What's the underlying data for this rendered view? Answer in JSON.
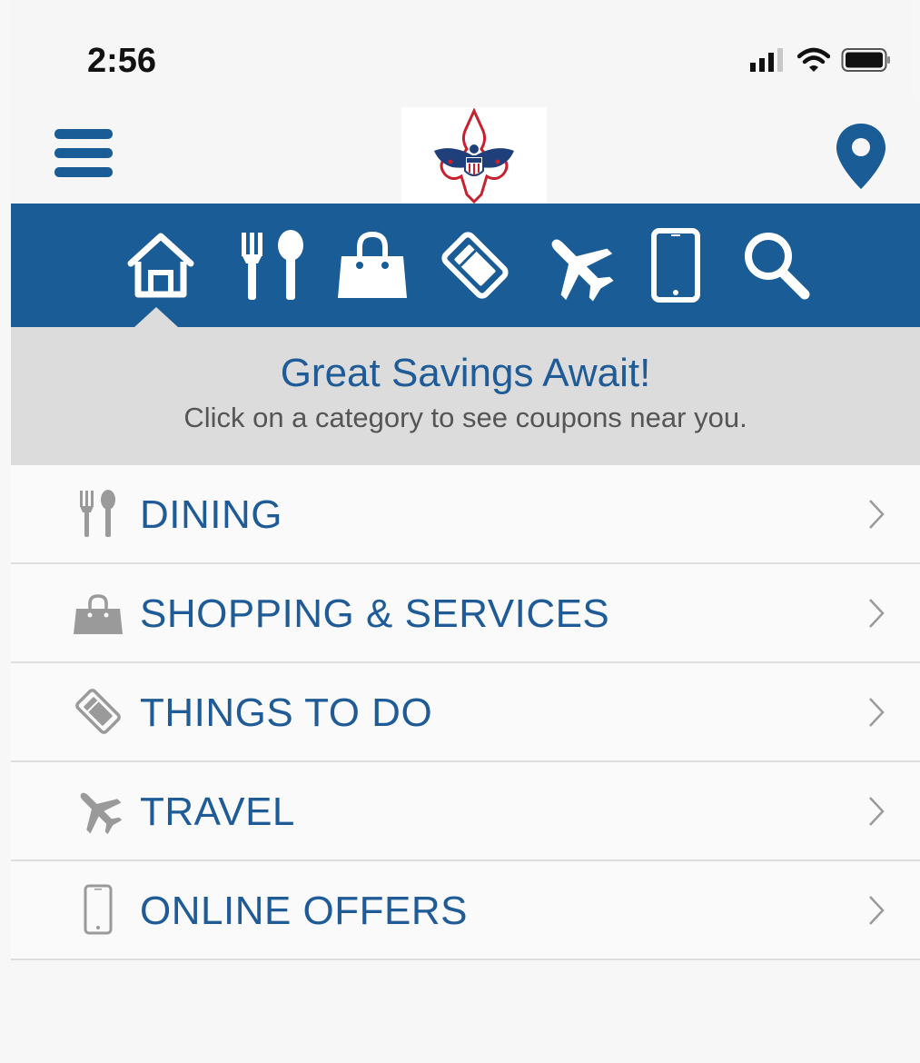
{
  "status_bar": {
    "time": "2:56",
    "icons": [
      "signal-icon",
      "wifi-icon",
      "battery-icon"
    ]
  },
  "header": {
    "menu_icon": "hamburger-menu-icon",
    "logo": "fleur-de-lis-eagle-logo",
    "location_icon": "map-pin-icon"
  },
  "category_nav": {
    "color": "#1a5c96",
    "items": [
      {
        "name": "home",
        "icon": "home-icon",
        "active": true
      },
      {
        "name": "dining",
        "icon": "fork-spoon-icon"
      },
      {
        "name": "shopping",
        "icon": "shopping-bag-icon"
      },
      {
        "name": "things-to-do",
        "icon": "ticket-icon"
      },
      {
        "name": "travel",
        "icon": "airplane-icon"
      },
      {
        "name": "online",
        "icon": "mobile-phone-icon"
      },
      {
        "name": "search",
        "icon": "search-icon"
      }
    ]
  },
  "banner": {
    "title": "Great Savings Await!",
    "subtitle": "Click on a category to see coupons near you."
  },
  "categories": [
    {
      "label": "DINING",
      "icon": "fork-spoon-icon"
    },
    {
      "label": "SHOPPING & SERVICES",
      "icon": "shopping-bag-icon"
    },
    {
      "label": "THINGS TO DO",
      "icon": "ticket-icon"
    },
    {
      "label": "TRAVEL",
      "icon": "airplane-icon"
    },
    {
      "label": "ONLINE OFFERS",
      "icon": "mobile-phone-icon"
    }
  ],
  "colors": {
    "brand_blue": "#1a5c96",
    "text_blue": "#1f5c97",
    "banner_gray": "#dcdcdc",
    "icon_gray": "#9a9a9a"
  }
}
